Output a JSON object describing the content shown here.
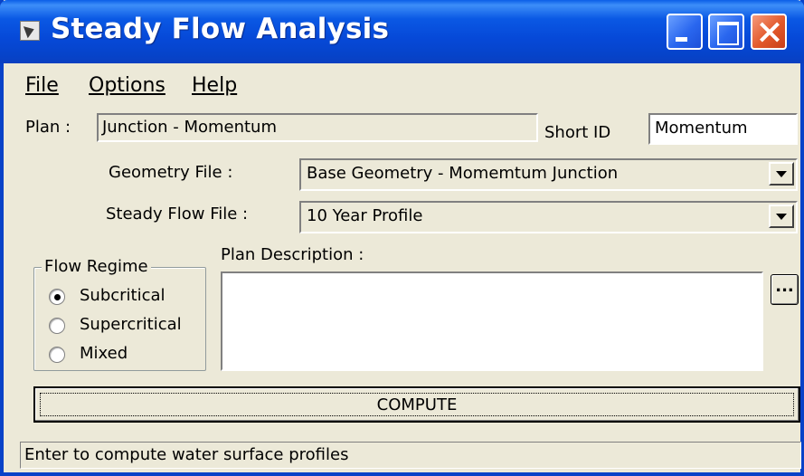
{
  "window": {
    "title": "Steady Flow Analysis",
    "accent_color": "#0842c8",
    "icon": "app-icon"
  },
  "menu": {
    "file": "File",
    "options": "Options",
    "help": "Help"
  },
  "plan": {
    "label": "Plan :",
    "value": "Junction - Momentum",
    "short_id_label": "Short ID",
    "short_id_value": "Momentum"
  },
  "geometry": {
    "label": "Geometry File :",
    "value": "Base Geometry - Momemtum Junction"
  },
  "steady_flow": {
    "label": "Steady Flow File :",
    "value": "10 Year Profile"
  },
  "flow_regime": {
    "label": "Flow Regime",
    "options": [
      "Subcritical",
      "Supercritical",
      "Mixed"
    ],
    "selected": "Subcritical"
  },
  "description": {
    "label": "Plan Description :",
    "value": "",
    "ellipsis": "..."
  },
  "compute": {
    "label": "COMPUTE"
  },
  "status": {
    "text": "Enter to compute water surface profiles"
  }
}
